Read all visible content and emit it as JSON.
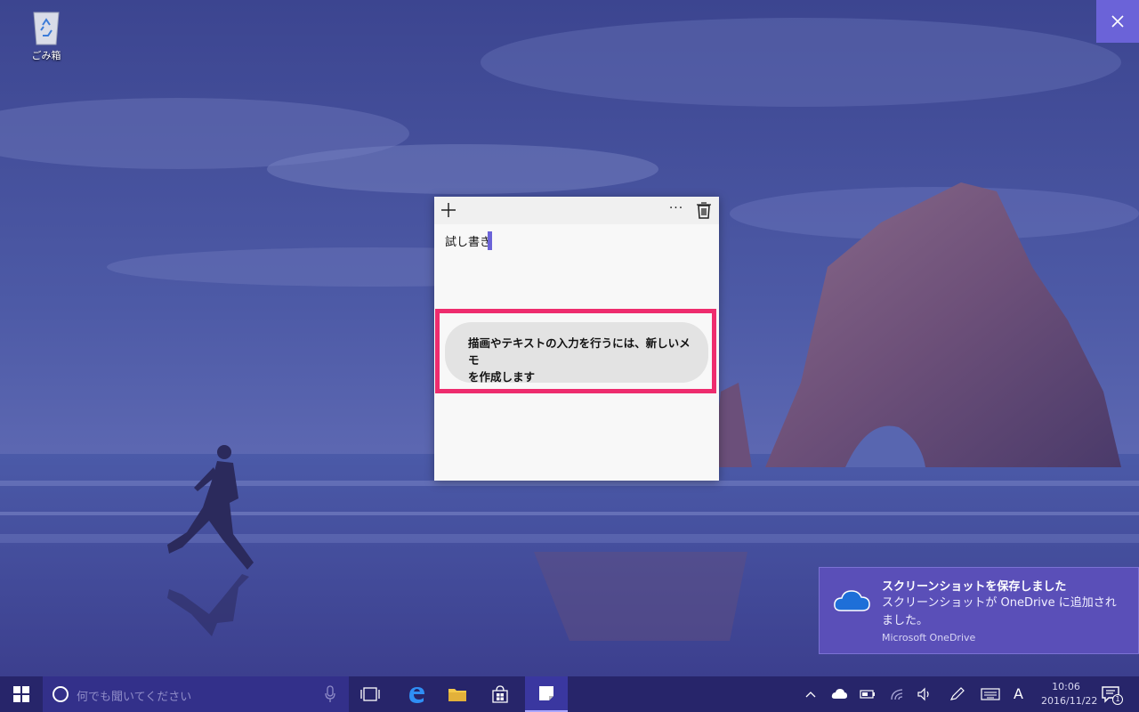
{
  "desktop": {
    "recycle_bin_label": "ごみ箱",
    "recycle_bin_icon": "recycle-bin-icon"
  },
  "close_button": {
    "icon": "close-icon"
  },
  "sticky_note": {
    "text": "試し書き",
    "add_icon": "plus-icon",
    "more_label": "···",
    "delete_icon": "trash-icon",
    "hint_line1": "描画やテキストの入力を行うには、新しいメモ",
    "hint_line2": "を作成します",
    "highlight_color": "#ee2c6e",
    "caret_color": "#6b63d8"
  },
  "toast": {
    "title": "スクリーンショットを保存しました",
    "body": "スクリーンショットが OneDrive に追加されました。",
    "source": "Microsoft OneDrive",
    "icon": "onedrive-cloud-icon",
    "background": "#5a4fb8"
  },
  "taskbar": {
    "start_icon": "windows-start-icon",
    "search_placeholder": "何でも聞いてください",
    "mic_icon": "microphone-icon",
    "taskview_icon": "task-view-icon",
    "edge_icon": "edge-icon",
    "explorer_icon": "file-explorer-icon",
    "store_icon": "store-icon",
    "sticky_notes_icon": "sticky-notes-icon",
    "tray": {
      "chevron_icon": "chevron-up-icon",
      "onedrive_icon": "onedrive-tray-icon",
      "battery_icon": "battery-icon",
      "wifi_icon": "wifi-icon",
      "volume_icon": "volume-icon",
      "pen_icon": "pen-icon",
      "keyboard_icon": "keyboard-icon",
      "ime_label": "A",
      "time": "10:06",
      "date": "2016/11/22",
      "action_center_icon": "action-center-icon",
      "notification_count": "1"
    }
  }
}
